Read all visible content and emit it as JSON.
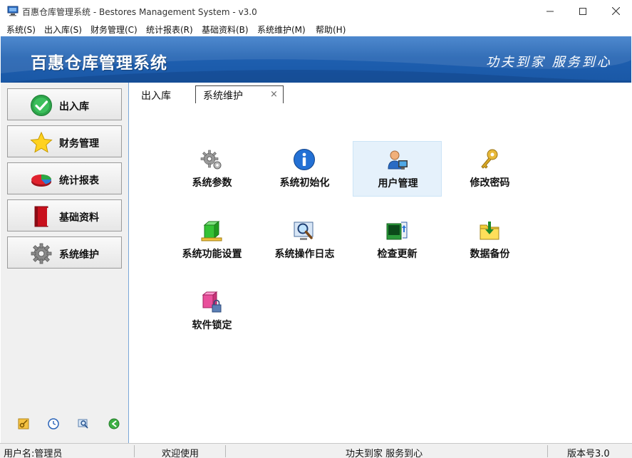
{
  "window": {
    "title": "百惠仓库管理系统 - Bestores Management System - v3.0",
    "icon": "computer-icon"
  },
  "menu": [
    "系统(S)",
    "出入库(S)",
    "财务管理(C)",
    "统计报表(R)",
    "基础资料(B)",
    "系统维护(M)",
    "帮助(H)"
  ],
  "banner": {
    "title": "百惠仓库管理系统",
    "slogan": "功夫到家 服务到心"
  },
  "sidebar": {
    "items": [
      {
        "label": "出入库",
        "icon": "checkmark-icon"
      },
      {
        "label": "财务管理",
        "icon": "star-icon"
      },
      {
        "label": "统计报表",
        "icon": "pie-chart-icon"
      },
      {
        "label": "基础资料",
        "icon": "book-icon"
      },
      {
        "label": "系统维护",
        "icon": "gear-icon"
      }
    ],
    "tools": [
      "key-icon",
      "clock-icon",
      "search-icon",
      "back-arrow-icon"
    ]
  },
  "tabs": [
    {
      "label": "出入库",
      "active": false
    },
    {
      "label": "系统维护",
      "active": true,
      "close": "×"
    }
  ],
  "tiles": [
    {
      "label": "系统参数",
      "icon": "gears-icon"
    },
    {
      "label": "系统初始化",
      "icon": "info-icon"
    },
    {
      "label": "用户管理",
      "icon": "user-monitor-icon",
      "selected": true
    },
    {
      "label": "修改密码",
      "icon": "keys-icon"
    },
    {
      "label": "系统功能设置",
      "icon": "green-cube-icon"
    },
    {
      "label": "系统操作日志",
      "icon": "magnifier-monitor-icon"
    },
    {
      "label": "检查更新",
      "icon": "update-icon"
    },
    {
      "label": "数据备份",
      "icon": "folder-download-icon"
    },
    {
      "label": "软件锁定",
      "icon": "lock-cube-icon"
    }
  ],
  "status": {
    "user": "用户名:管理员",
    "welcome": "欢迎使用",
    "slogan": "功夫到家 服务到心",
    "version": "版本号3.0"
  },
  "colors": {
    "banner": "#1e5fb0",
    "selected_tile": "#e5f1fb",
    "sidebar_bg": "#f0f0f0"
  }
}
